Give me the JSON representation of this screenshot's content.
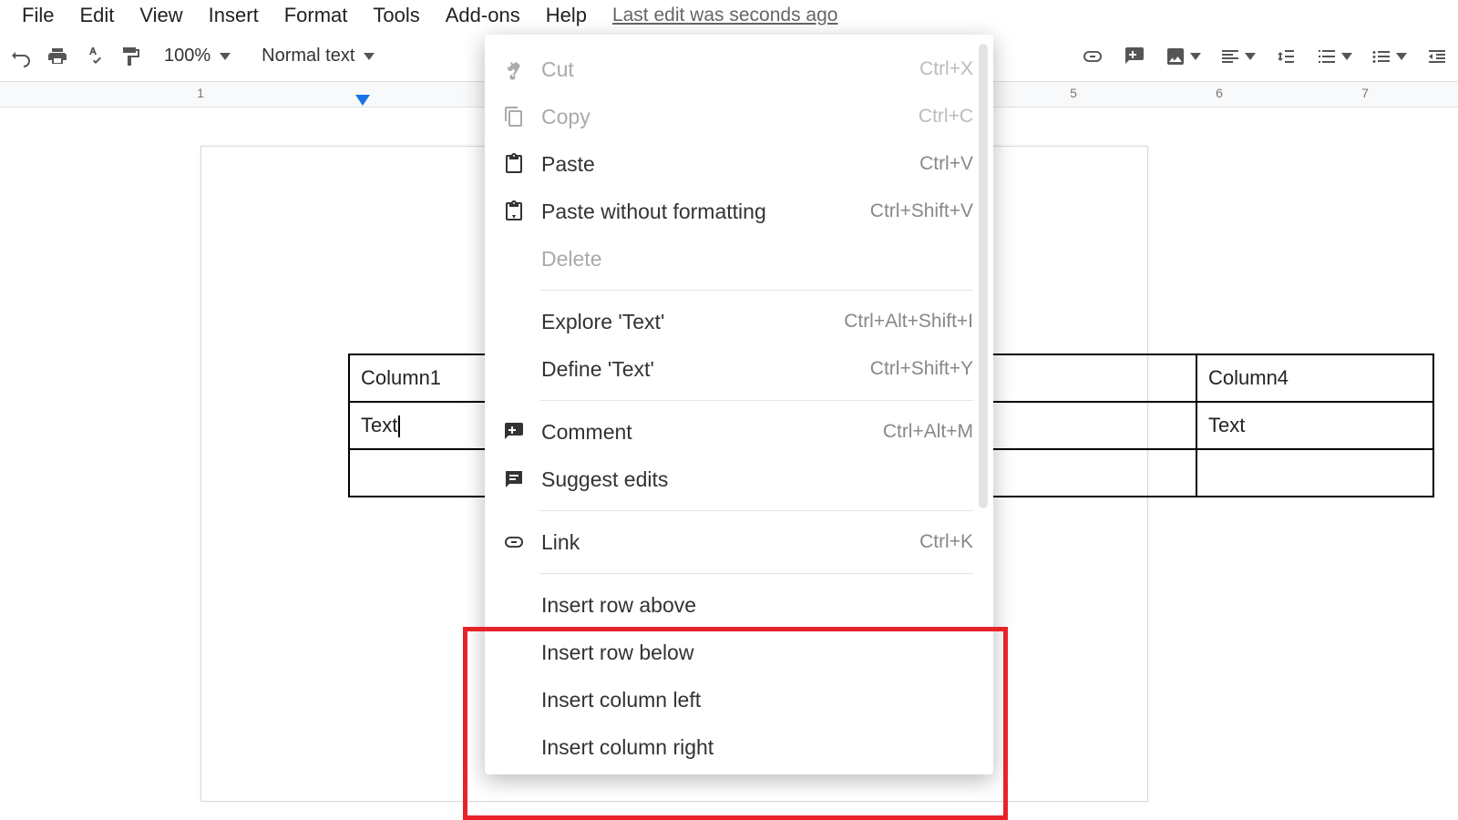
{
  "menubar": {
    "items": [
      "File",
      "Edit",
      "View",
      "Insert",
      "Format",
      "Tools",
      "Add-ons",
      "Help"
    ],
    "last_edit": "Last edit was seconds ago"
  },
  "toolbar": {
    "zoom": "100%",
    "style": "Normal text"
  },
  "ruler": {
    "marks": [
      "1",
      "5",
      "6",
      "7"
    ]
  },
  "table": {
    "headers": [
      "Column1",
      "Column4"
    ],
    "row1": [
      "Text",
      "Text"
    ]
  },
  "context_menu": [
    {
      "label": "Cut",
      "shortcut": "Ctrl+X",
      "icon": "cut",
      "disabled": true
    },
    {
      "label": "Copy",
      "shortcut": "Ctrl+C",
      "icon": "copy",
      "disabled": true
    },
    {
      "label": "Paste",
      "shortcut": "Ctrl+V",
      "icon": "paste",
      "disabled": false
    },
    {
      "label": "Paste without formatting",
      "shortcut": "Ctrl+Shift+V",
      "icon": "paste-plain",
      "disabled": false
    },
    {
      "label": "Delete",
      "shortcut": "",
      "icon": "",
      "disabled": true
    },
    {
      "sep": true
    },
    {
      "label": "Explore 'Text'",
      "shortcut": "Ctrl+Alt+Shift+I",
      "icon": "",
      "disabled": false
    },
    {
      "label": "Define 'Text'",
      "shortcut": "Ctrl+Shift+Y",
      "icon": "",
      "disabled": false
    },
    {
      "sep": true
    },
    {
      "label": "Comment",
      "shortcut": "Ctrl+Alt+M",
      "icon": "comment",
      "disabled": false
    },
    {
      "label": "Suggest edits",
      "shortcut": "",
      "icon": "suggest",
      "disabled": false
    },
    {
      "sep": true
    },
    {
      "label": "Link",
      "shortcut": "Ctrl+K",
      "icon": "link",
      "disabled": false
    },
    {
      "sep": true
    },
    {
      "label": "Insert row above",
      "shortcut": "",
      "icon": "",
      "disabled": false
    },
    {
      "label": "Insert row below",
      "shortcut": "",
      "icon": "",
      "disabled": false
    },
    {
      "label": "Insert column left",
      "shortcut": "",
      "icon": "",
      "disabled": false
    },
    {
      "label": "Insert column right",
      "shortcut": "",
      "icon": "",
      "disabled": false
    }
  ]
}
